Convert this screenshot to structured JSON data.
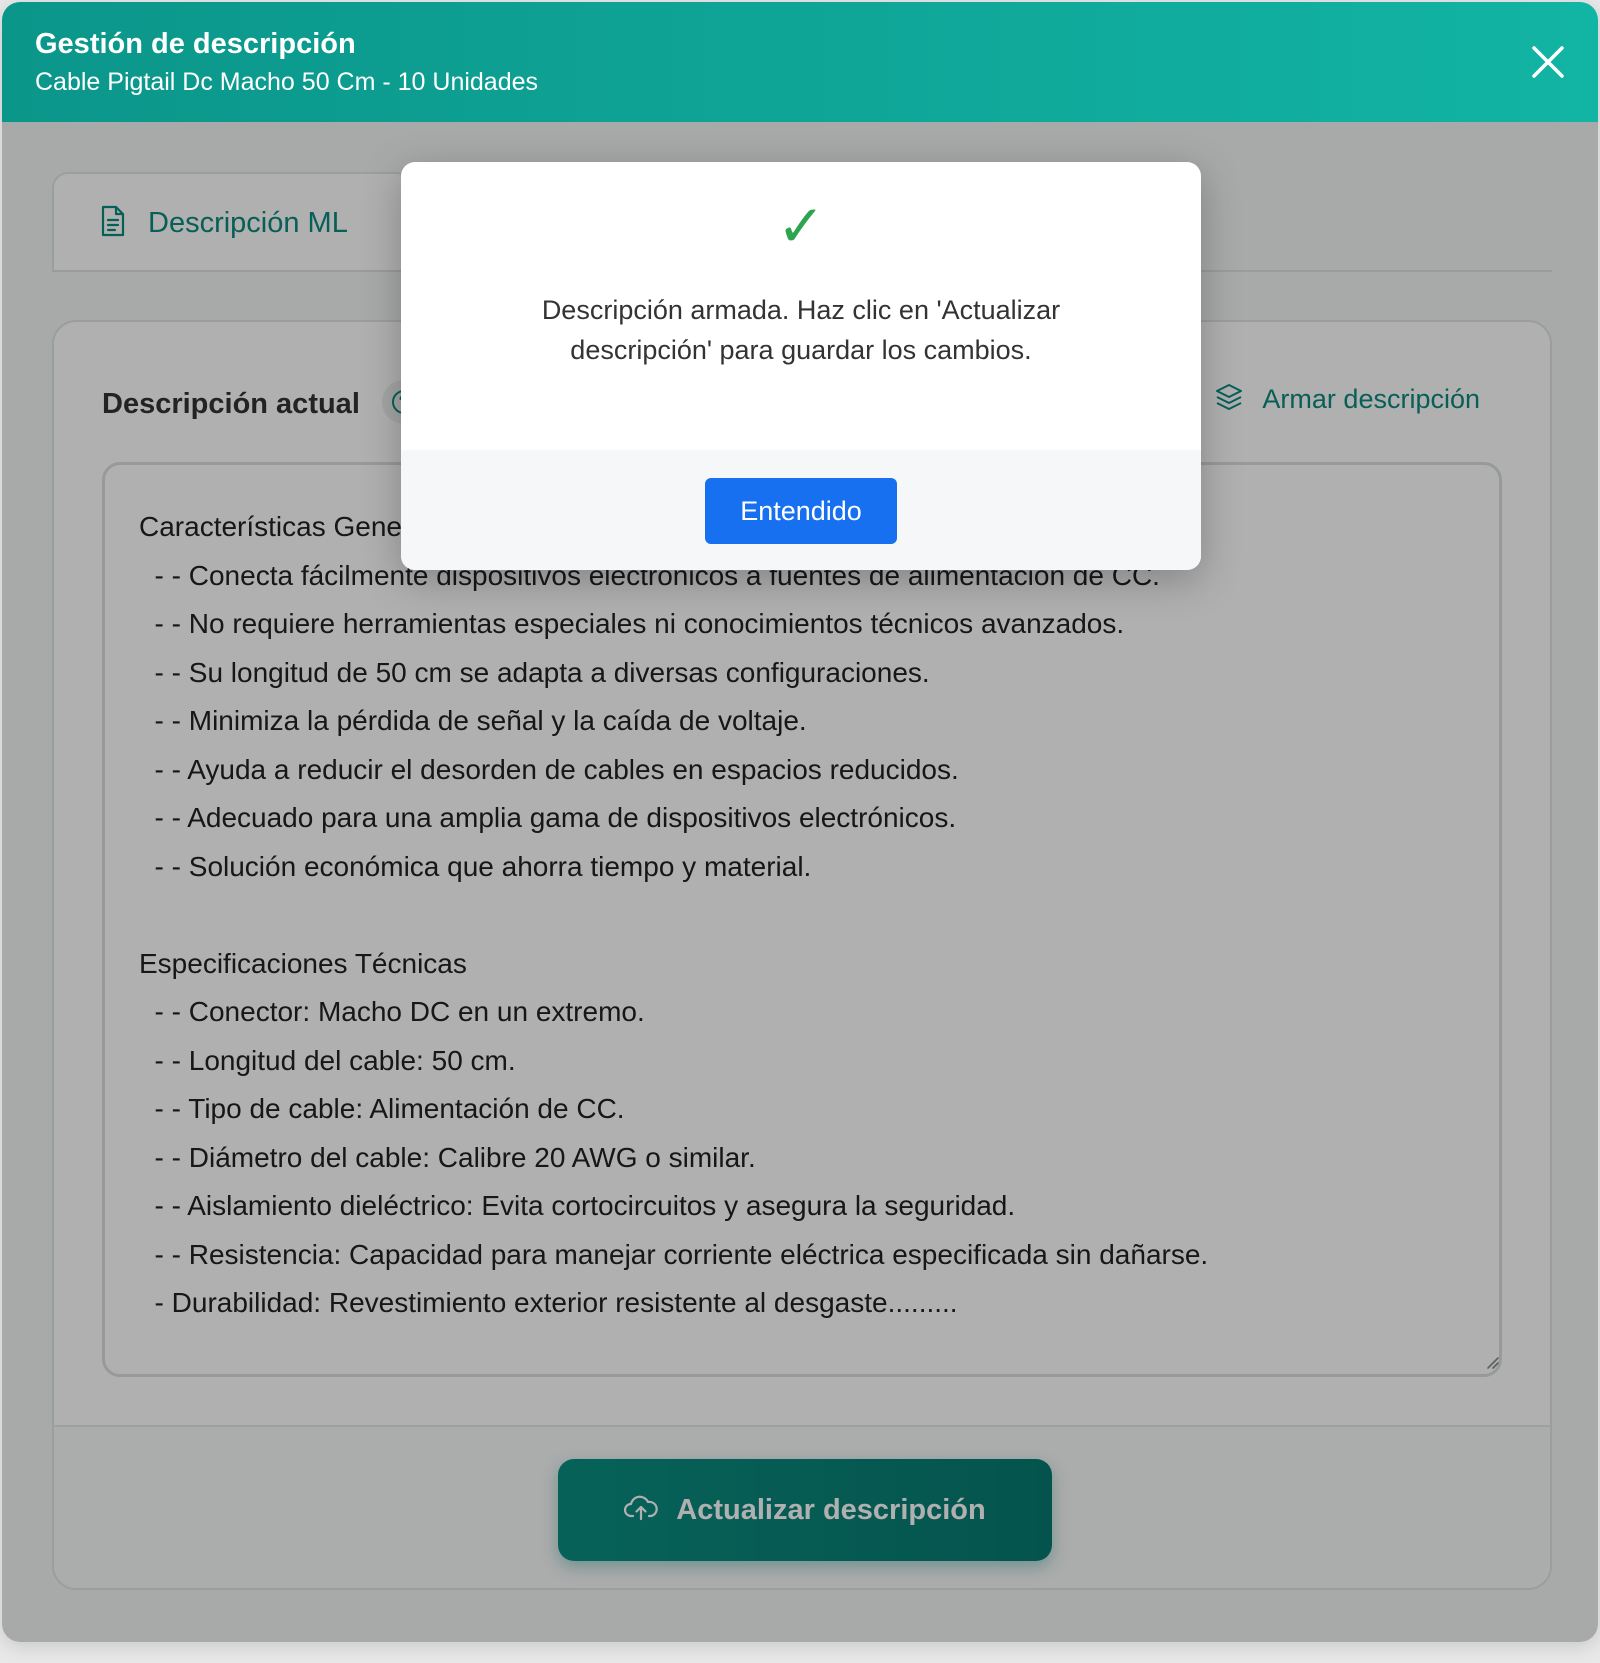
{
  "header": {
    "title": "Gestión de descripción",
    "subtitle": "Cable Pigtail Dc Macho 50 Cm - 10 Unidades",
    "close_icon": "close-icon"
  },
  "tabs": [
    {
      "label": "Descripción ML",
      "icon": "document-icon",
      "active": true
    }
  ],
  "card": {
    "label": "Descripción actual",
    "help_icon": "question-circle-icon",
    "armar_label": "Armar descripción",
    "armar_icon": "layers-icon",
    "textarea_value": "Características Generales\n  - - Conecta fácilmente dispositivos electrónicos a fuentes de alimentación de CC.\n  - - No requiere herramientas especiales ni conocimientos técnicos avanzados.\n  - - Su longitud de 50 cm se adapta a diversas configuraciones.\n  - - Minimiza la pérdida de señal y la caída de voltaje.\n  - - Ayuda a reducir el desorden de cables en espacios reducidos.\n  - - Adecuado para una amplia gama de dispositivos electrónicos.\n  - - Solución económica que ahorra tiempo y material.\n\nEspecificaciones Técnicas\n  - - Conector: Macho DC en un extremo.\n  - - Longitud del cable: 50 cm.\n  - - Tipo de cable: Alimentación de CC.\n  - - Diámetro del cable: Calibre 20 AWG o similar.\n  - - Aislamiento dieléctrico: Evita cortocircuitos y asegura la seguridad.\n  - - Resistencia: Capacidad para manejar corriente eléctrica especificada sin dañarse.\n  - Durabilidad: Revestimiento exterior resistente al desgaste.........",
    "update_label": "Actualizar descripción",
    "update_icon": "cloud-upload-icon"
  },
  "modal": {
    "icon": "✓",
    "message": "Descripción armada. Haz clic en 'Actualizar descripción' para guardar los cambios.",
    "ok_label": "Entendido"
  },
  "colors": {
    "header_start": "#0b968a",
    "header_end": "#12b4a4",
    "accent": "#0c8a7e",
    "primary_button": "#1670f0",
    "success": "#2ea44f"
  }
}
